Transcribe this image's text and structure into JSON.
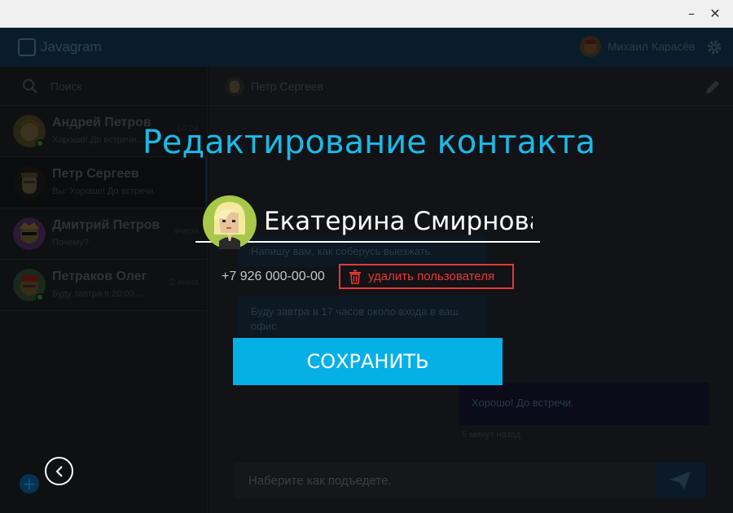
{
  "window": {
    "minimize_glyph": "–",
    "close_glyph": "✕"
  },
  "header": {
    "app_name": "Javagram",
    "current_user": "Михаил Карасёв"
  },
  "search": {
    "placeholder": "Поиск"
  },
  "contacts": [
    {
      "name": "Андрей Петров",
      "message": "Хорошо! До встречи...",
      "time": "10:24",
      "online": true
    },
    {
      "name": "Петр Сергеев",
      "message": "Вы: Хорошо! До встречи.",
      "time": "",
      "online": false,
      "active": true
    },
    {
      "name": "Дмитрий Петров",
      "message": "Почему?",
      "time": "вчера",
      "online": false
    },
    {
      "name": "Петраков Олег",
      "message": "Буду завтра в 20:00....",
      "time": "2 июня",
      "online": true
    }
  ],
  "chat": {
    "contact_name": "Петр Сергеев",
    "messages": [
      {
        "text": "Напишу вам, как соберусь выезжать."
      },
      {
        "text": "Буду завтра в 17 часов около входа в ваш офис"
      },
      {
        "text": "Хорошо! До встречи.",
        "time": "5 минут назад"
      }
    ],
    "compose_placeholder": "Наберите как подъедете."
  },
  "modal": {
    "title": "Редактирование контакта",
    "name_value": "Екатерина Смирнова",
    "phone": "+7 926 000-00-00",
    "delete_label": "удалить пользователя",
    "save_label": "СОХРАНИТЬ"
  },
  "colors": {
    "accent": "#05b0e6",
    "title": "#1cb9e6",
    "danger": "#e53935"
  }
}
